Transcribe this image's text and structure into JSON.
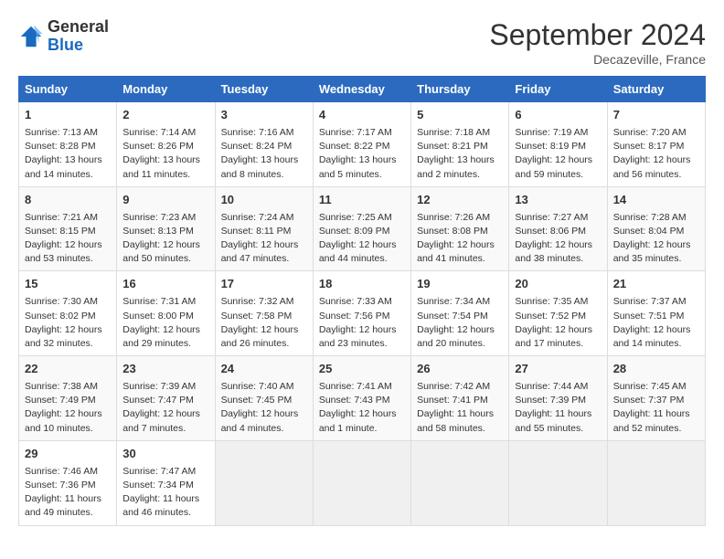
{
  "header": {
    "logo_general": "General",
    "logo_blue": "Blue",
    "month_title": "September 2024",
    "location": "Decazeville, France"
  },
  "weekdays": [
    "Sunday",
    "Monday",
    "Tuesday",
    "Wednesday",
    "Thursday",
    "Friday",
    "Saturday"
  ],
  "weeks": [
    [
      {
        "day": "1",
        "lines": [
          "Sunrise: 7:13 AM",
          "Sunset: 8:28 PM",
          "Daylight: 13 hours",
          "and 14 minutes."
        ]
      },
      {
        "day": "2",
        "lines": [
          "Sunrise: 7:14 AM",
          "Sunset: 8:26 PM",
          "Daylight: 13 hours",
          "and 11 minutes."
        ]
      },
      {
        "day": "3",
        "lines": [
          "Sunrise: 7:16 AM",
          "Sunset: 8:24 PM",
          "Daylight: 13 hours",
          "and 8 minutes."
        ]
      },
      {
        "day": "4",
        "lines": [
          "Sunrise: 7:17 AM",
          "Sunset: 8:22 PM",
          "Daylight: 13 hours",
          "and 5 minutes."
        ]
      },
      {
        "day": "5",
        "lines": [
          "Sunrise: 7:18 AM",
          "Sunset: 8:21 PM",
          "Daylight: 13 hours",
          "and 2 minutes."
        ]
      },
      {
        "day": "6",
        "lines": [
          "Sunrise: 7:19 AM",
          "Sunset: 8:19 PM",
          "Daylight: 12 hours",
          "and 59 minutes."
        ]
      },
      {
        "day": "7",
        "lines": [
          "Sunrise: 7:20 AM",
          "Sunset: 8:17 PM",
          "Daylight: 12 hours",
          "and 56 minutes."
        ]
      }
    ],
    [
      {
        "day": "8",
        "lines": [
          "Sunrise: 7:21 AM",
          "Sunset: 8:15 PM",
          "Daylight: 12 hours",
          "and 53 minutes."
        ]
      },
      {
        "day": "9",
        "lines": [
          "Sunrise: 7:23 AM",
          "Sunset: 8:13 PM",
          "Daylight: 12 hours",
          "and 50 minutes."
        ]
      },
      {
        "day": "10",
        "lines": [
          "Sunrise: 7:24 AM",
          "Sunset: 8:11 PM",
          "Daylight: 12 hours",
          "and 47 minutes."
        ]
      },
      {
        "day": "11",
        "lines": [
          "Sunrise: 7:25 AM",
          "Sunset: 8:09 PM",
          "Daylight: 12 hours",
          "and 44 minutes."
        ]
      },
      {
        "day": "12",
        "lines": [
          "Sunrise: 7:26 AM",
          "Sunset: 8:08 PM",
          "Daylight: 12 hours",
          "and 41 minutes."
        ]
      },
      {
        "day": "13",
        "lines": [
          "Sunrise: 7:27 AM",
          "Sunset: 8:06 PM",
          "Daylight: 12 hours",
          "and 38 minutes."
        ]
      },
      {
        "day": "14",
        "lines": [
          "Sunrise: 7:28 AM",
          "Sunset: 8:04 PM",
          "Daylight: 12 hours",
          "and 35 minutes."
        ]
      }
    ],
    [
      {
        "day": "15",
        "lines": [
          "Sunrise: 7:30 AM",
          "Sunset: 8:02 PM",
          "Daylight: 12 hours",
          "and 32 minutes."
        ]
      },
      {
        "day": "16",
        "lines": [
          "Sunrise: 7:31 AM",
          "Sunset: 8:00 PM",
          "Daylight: 12 hours",
          "and 29 minutes."
        ]
      },
      {
        "day": "17",
        "lines": [
          "Sunrise: 7:32 AM",
          "Sunset: 7:58 PM",
          "Daylight: 12 hours",
          "and 26 minutes."
        ]
      },
      {
        "day": "18",
        "lines": [
          "Sunrise: 7:33 AM",
          "Sunset: 7:56 PM",
          "Daylight: 12 hours",
          "and 23 minutes."
        ]
      },
      {
        "day": "19",
        "lines": [
          "Sunrise: 7:34 AM",
          "Sunset: 7:54 PM",
          "Daylight: 12 hours",
          "and 20 minutes."
        ]
      },
      {
        "day": "20",
        "lines": [
          "Sunrise: 7:35 AM",
          "Sunset: 7:52 PM",
          "Daylight: 12 hours",
          "and 17 minutes."
        ]
      },
      {
        "day": "21",
        "lines": [
          "Sunrise: 7:37 AM",
          "Sunset: 7:51 PM",
          "Daylight: 12 hours",
          "and 14 minutes."
        ]
      }
    ],
    [
      {
        "day": "22",
        "lines": [
          "Sunrise: 7:38 AM",
          "Sunset: 7:49 PM",
          "Daylight: 12 hours",
          "and 10 minutes."
        ]
      },
      {
        "day": "23",
        "lines": [
          "Sunrise: 7:39 AM",
          "Sunset: 7:47 PM",
          "Daylight: 12 hours",
          "and 7 minutes."
        ]
      },
      {
        "day": "24",
        "lines": [
          "Sunrise: 7:40 AM",
          "Sunset: 7:45 PM",
          "Daylight: 12 hours",
          "and 4 minutes."
        ]
      },
      {
        "day": "25",
        "lines": [
          "Sunrise: 7:41 AM",
          "Sunset: 7:43 PM",
          "Daylight: 12 hours",
          "and 1 minute."
        ]
      },
      {
        "day": "26",
        "lines": [
          "Sunrise: 7:42 AM",
          "Sunset: 7:41 PM",
          "Daylight: 11 hours",
          "and 58 minutes."
        ]
      },
      {
        "day": "27",
        "lines": [
          "Sunrise: 7:44 AM",
          "Sunset: 7:39 PM",
          "Daylight: 11 hours",
          "and 55 minutes."
        ]
      },
      {
        "day": "28",
        "lines": [
          "Sunrise: 7:45 AM",
          "Sunset: 7:37 PM",
          "Daylight: 11 hours",
          "and 52 minutes."
        ]
      }
    ],
    [
      {
        "day": "29",
        "lines": [
          "Sunrise: 7:46 AM",
          "Sunset: 7:36 PM",
          "Daylight: 11 hours",
          "and 49 minutes."
        ]
      },
      {
        "day": "30",
        "lines": [
          "Sunrise: 7:47 AM",
          "Sunset: 7:34 PM",
          "Daylight: 11 hours",
          "and 46 minutes."
        ]
      },
      null,
      null,
      null,
      null,
      null
    ]
  ]
}
